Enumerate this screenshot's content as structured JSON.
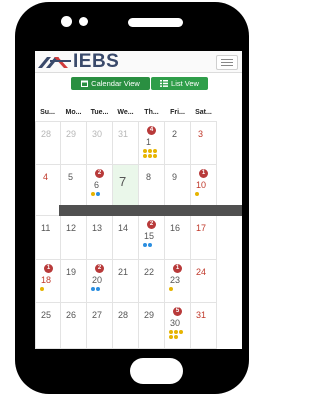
{
  "app": {
    "logo_text": "IEBS"
  },
  "toolbar": {
    "calendar_view_label": "Calendar View",
    "list_view_label": "List Vew"
  },
  "weekdays": [
    "Su...",
    "Mo...",
    "Tue...",
    "We...",
    "Th...",
    "Fri...",
    "Sat..."
  ],
  "weeks": [
    [
      {
        "day": "28",
        "muted": true
      },
      {
        "day": "29",
        "muted": true
      },
      {
        "day": "30",
        "muted": true
      },
      {
        "day": "31",
        "muted": true
      },
      {
        "day": "1",
        "badge": "4",
        "dots": [
          "y",
          "y",
          "y",
          "y",
          "y",
          "y"
        ]
      },
      {
        "day": "2"
      },
      {
        "day": "3",
        "red": true
      }
    ],
    [
      {
        "day": "4",
        "red": true
      },
      {
        "day": "5"
      },
      {
        "day": "6",
        "badge": "2",
        "dots": [
          "y",
          "b"
        ]
      },
      {
        "day": "7",
        "today": true
      },
      {
        "day": "8"
      },
      {
        "day": "9"
      },
      {
        "day": "10",
        "red": true,
        "badge": "1",
        "dots": [
          "y"
        ]
      }
    ],
    [
      {
        "day": "11"
      },
      {
        "day": "12"
      },
      {
        "day": "13"
      },
      {
        "day": "14"
      },
      {
        "day": "15",
        "badge": "2",
        "dots": [
          "b",
          "b"
        ]
      },
      {
        "day": "16"
      },
      {
        "day": "17",
        "red": true
      }
    ],
    [
      {
        "day": "18",
        "red": true,
        "badge": "1",
        "dots": [
          "y"
        ]
      },
      {
        "day": "19"
      },
      {
        "day": "20",
        "badge": "2",
        "dots": [
          "b",
          "b"
        ]
      },
      {
        "day": "21"
      },
      {
        "day": "22"
      },
      {
        "day": "23",
        "badge": "1",
        "dots": [
          "y"
        ]
      },
      {
        "day": "24",
        "red": true
      }
    ],
    [
      {
        "day": "25"
      },
      {
        "day": "26"
      },
      {
        "day": "27"
      },
      {
        "day": "28"
      },
      {
        "day": "29"
      },
      {
        "day": "30",
        "badge": "5",
        "dots": [
          "y",
          "y",
          "y",
          "y",
          "y"
        ]
      },
      {
        "day": "31",
        "red": true
      }
    ]
  ],
  "colors": {
    "accent_green": "#2f9e4a",
    "badge_red": "#b83a3a",
    "dot_yellow": "#e6b400",
    "dot_blue": "#2b8ee0",
    "today_bg": "#eaf7ea"
  }
}
